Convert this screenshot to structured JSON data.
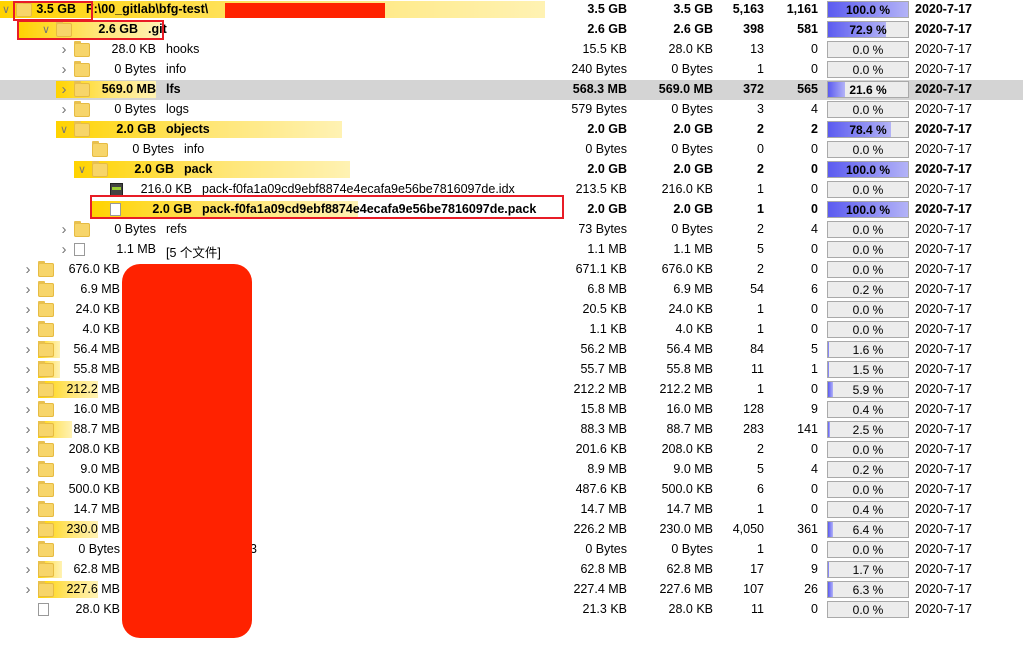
{
  "rows": [
    {
      "size": "3.5 GB",
      "name": "F:\\00_gitlab\\bfg-test\\",
      "cols": [
        "3.5 GB",
        "3.5 GB",
        "5,163",
        "1,161"
      ],
      "pct": "100.0 %",
      "pct_value": 100.0,
      "date": "2020-7-17",
      "bold": true
    },
    {
      "size": "2.6 GB",
      "name": ".git",
      "cols": [
        "2.6 GB",
        "2.6 GB",
        "398",
        "581"
      ],
      "pct": "72.9 %",
      "pct_value": 72.9,
      "date": "2020-7-17",
      "bold": true
    },
    {
      "size": "28.0 KB",
      "name": "hooks",
      "cols": [
        "15.5 KB",
        "28.0 KB",
        "13",
        "0"
      ],
      "pct": "0.0 %",
      "pct_value": 0.0,
      "date": "2020-7-17"
    },
    {
      "size": "0 Bytes",
      "name": "info",
      "cols": [
        "240 Bytes",
        "0 Bytes",
        "1",
        "0"
      ],
      "pct": "0.0 %",
      "pct_value": 0.0,
      "date": "2020-7-17"
    },
    {
      "size": "569.0 MB",
      "name": "lfs",
      "cols": [
        "568.3 MB",
        "569.0 MB",
        "372",
        "565"
      ],
      "pct": "21.6 %",
      "pct_value": 21.6,
      "date": "2020-7-17",
      "bold": true
    },
    {
      "size": "0 Bytes",
      "name": "logs",
      "cols": [
        "579 Bytes",
        "0 Bytes",
        "3",
        "4"
      ],
      "pct": "0.0 %",
      "pct_value": 0.0,
      "date": "2020-7-17"
    },
    {
      "size": "2.0 GB",
      "name": "objects",
      "cols": [
        "2.0 GB",
        "2.0 GB",
        "2",
        "2"
      ],
      "pct": "78.4 %",
      "pct_value": 78.4,
      "date": "2020-7-17",
      "bold": true
    },
    {
      "size": "0 Bytes",
      "name": "info",
      "cols": [
        "0 Bytes",
        "0 Bytes",
        "0",
        "0"
      ],
      "pct": "0.0 %",
      "pct_value": 0.0,
      "date": "2020-7-17"
    },
    {
      "size": "2.0 GB",
      "name": "pack",
      "cols": [
        "2.0 GB",
        "2.0 GB",
        "2",
        "0"
      ],
      "pct": "100.0 %",
      "pct_value": 100.0,
      "date": "2020-7-17",
      "bold": true
    },
    {
      "size": "216.0 KB",
      "name": "pack-f0fa1a09cd9ebf8874e4ecafa9e56be7816097de.idx",
      "cols": [
        "213.5 KB",
        "216.0 KB",
        "1",
        "0"
      ],
      "pct": "0.0 %",
      "pct_value": 0.0,
      "date": "2020-7-17"
    },
    {
      "size": "2.0 GB",
      "name": "pack-f0fa1a09cd9ebf8874e4ecafa9e56be7816097de.pack",
      "cols": [
        "2.0 GB",
        "2.0 GB",
        "1",
        "0"
      ],
      "pct": "100.0 %",
      "pct_value": 100.0,
      "date": "2020-7-17",
      "bold": true
    },
    {
      "size": "0 Bytes",
      "name": "refs",
      "cols": [
        "73 Bytes",
        "0 Bytes",
        "2",
        "4"
      ],
      "pct": "0.0 %",
      "pct_value": 0.0,
      "date": "2020-7-17"
    },
    {
      "size": "1.1 MB",
      "name": "[5 个文件]",
      "cols": [
        "1.1 MB",
        "1.1 MB",
        "5",
        "0"
      ],
      "pct": "0.0 %",
      "pct_value": 0.0,
      "date": "2020-7-17"
    },
    {
      "size": "676.0 KB",
      "name": "",
      "cols": [
        "671.1 KB",
        "676.0 KB",
        "2",
        "0"
      ],
      "pct": "0.0 %",
      "pct_value": 0.0,
      "date": "2020-7-17"
    },
    {
      "size": "6.9 MB",
      "name": "",
      "cols": [
        "6.8 MB",
        "6.9 MB",
        "54",
        "6"
      ],
      "pct": "0.2 %",
      "pct_value": 0.2,
      "date": "2020-7-17"
    },
    {
      "size": "24.0 KB",
      "name": "",
      "cols": [
        "20.5 KB",
        "24.0 KB",
        "1",
        "0"
      ],
      "pct": "0.0 %",
      "pct_value": 0.0,
      "date": "2020-7-17"
    },
    {
      "size": "4.0 KB",
      "name": "",
      "cols": [
        "1.1 KB",
        "4.0 KB",
        "1",
        "0"
      ],
      "pct": "0.0 %",
      "pct_value": 0.0,
      "date": "2020-7-17"
    },
    {
      "size": "56.4 MB",
      "name": "",
      "cols": [
        "56.2 MB",
        "56.4 MB",
        "84",
        "5"
      ],
      "pct": "1.6 %",
      "pct_value": 1.6,
      "date": "2020-7-17"
    },
    {
      "size": "55.8 MB",
      "name": "",
      "cols": [
        "55.7 MB",
        "55.8 MB",
        "11",
        "1"
      ],
      "pct": "1.5 %",
      "pct_value": 1.5,
      "date": "2020-7-17"
    },
    {
      "size": "212.2 MB",
      "name": "",
      "cols": [
        "212.2 MB",
        "212.2 MB",
        "1",
        "0"
      ],
      "pct": "5.9 %",
      "pct_value": 5.9,
      "date": "2020-7-17"
    },
    {
      "size": "16.0 MB",
      "name": "",
      "cols": [
        "15.8 MB",
        "16.0 MB",
        "128",
        "9"
      ],
      "pct": "0.4 %",
      "pct_value": 0.4,
      "date": "2020-7-17"
    },
    {
      "size": "88.7 MB",
      "name": "",
      "cols": [
        "88.3 MB",
        "88.7 MB",
        "283",
        "141"
      ],
      "pct": "2.5 %",
      "pct_value": 2.5,
      "date": "2020-7-17"
    },
    {
      "size": "208.0 KB",
      "name": "",
      "cols": [
        "201.6 KB",
        "208.0 KB",
        "2",
        "0"
      ],
      "pct": "0.0 %",
      "pct_value": 0.0,
      "date": "2020-7-17"
    },
    {
      "size": "9.0 MB",
      "name": "",
      "cols": [
        "8.9 MB",
        "9.0 MB",
        "5",
        "4"
      ],
      "pct": "0.2 %",
      "pct_value": 0.2,
      "date": "2020-7-17"
    },
    {
      "size": "500.0 KB",
      "name": "",
      "cols": [
        "487.6 KB",
        "500.0 KB",
        "6",
        "0"
      ],
      "pct": "0.0 %",
      "pct_value": 0.0,
      "date": "2020-7-17"
    },
    {
      "size": "14.7 MB",
      "name": "",
      "cols": [
        "14.7 MB",
        "14.7 MB",
        "1",
        "0"
      ],
      "pct": "0.4 %",
      "pct_value": 0.4,
      "date": "2020-7-17"
    },
    {
      "size": "230.0 MB",
      "name": "",
      "cols": [
        "226.2 MB",
        "230.0 MB",
        "4,050",
        "361"
      ],
      "pct": "6.4 %",
      "pct_value": 6.4,
      "date": "2020-7-17"
    },
    {
      "size": "0 Bytes",
      "name": "3",
      "cols": [
        "0 Bytes",
        "0 Bytes",
        "1",
        "0"
      ],
      "pct": "0.0 %",
      "pct_value": 0.0,
      "date": "2020-7-17"
    },
    {
      "size": "62.8 MB",
      "name": "",
      "cols": [
        "62.8 MB",
        "62.8 MB",
        "17",
        "9"
      ],
      "pct": "1.7 %",
      "pct_value": 1.7,
      "date": "2020-7-17"
    },
    {
      "size": "227.6 MB",
      "name": "",
      "cols": [
        "227.4 MB",
        "227.6 MB",
        "107",
        "26"
      ],
      "pct": "6.3 %",
      "pct_value": 6.3,
      "date": "2020-7-17"
    },
    {
      "size": "28.0 KB",
      "name": "",
      "cols": [
        "21.3 KB",
        "28.0 KB",
        "11",
        "0"
      ],
      "pct": "0.0 %",
      "pct_value": 0.0,
      "date": "2020-7-17"
    }
  ]
}
